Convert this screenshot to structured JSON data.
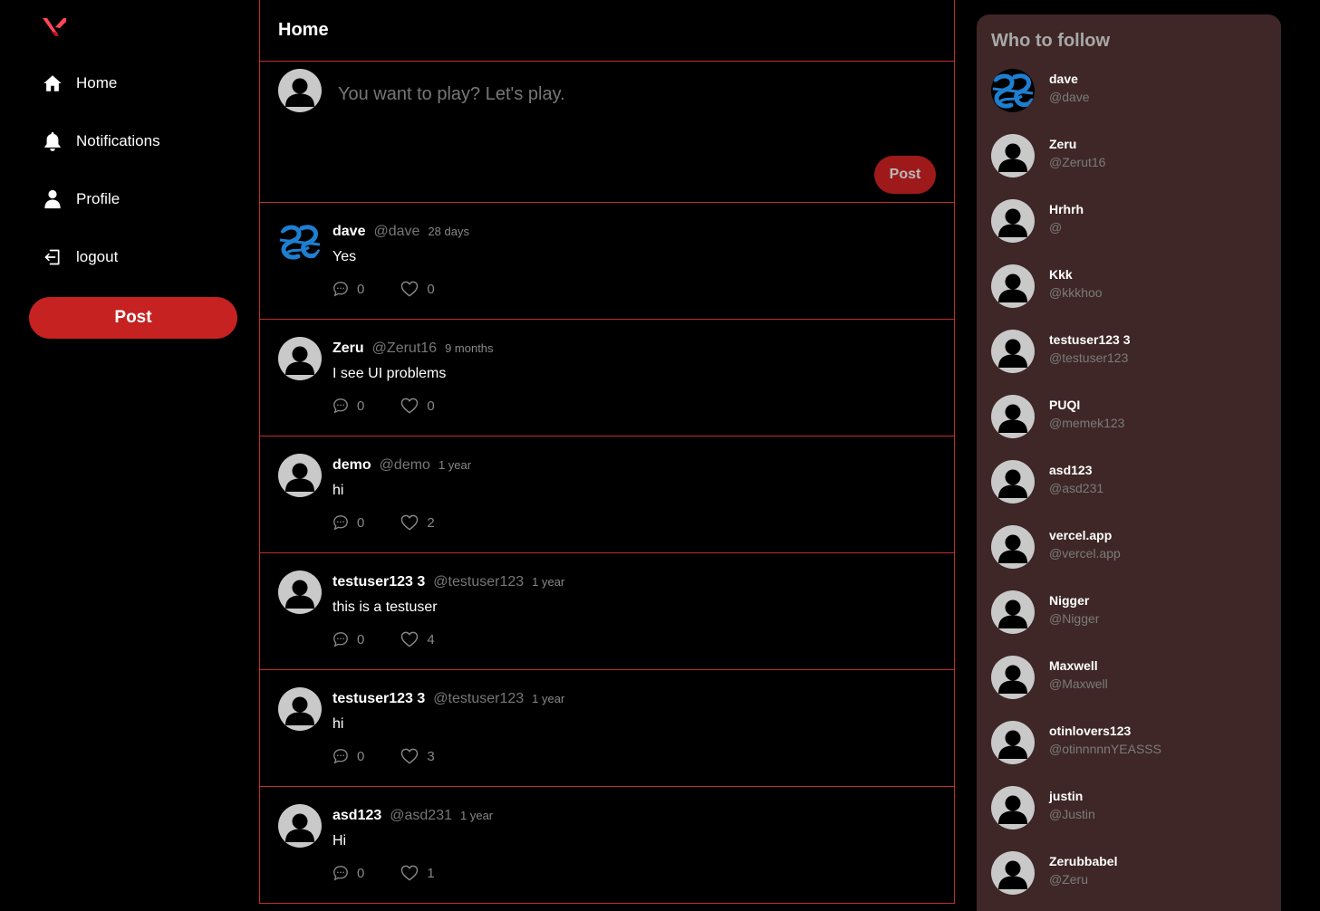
{
  "sidebar": {
    "logo": "v-logo-icon",
    "nav": [
      {
        "label": "Home",
        "icon": "home-icon"
      },
      {
        "label": "Notifications",
        "icon": "bell-icon"
      },
      {
        "label": "Profile",
        "icon": "user-icon"
      },
      {
        "label": "logout",
        "icon": "logout-icon"
      }
    ],
    "post_button": "Post"
  },
  "main": {
    "title": "Home",
    "composer": {
      "placeholder": "You want to play? Let's play.",
      "post_button": "Post"
    },
    "tweets": [
      {
        "name": "dave",
        "handle": "@dave",
        "time": "28 days",
        "text": "Yes",
        "replies": "0",
        "likes": "0",
        "avatar": "brand"
      },
      {
        "name": "Zeru",
        "handle": "@Zerut16",
        "time": "9 months",
        "text": "I see UI problems",
        "replies": "0",
        "likes": "0",
        "avatar": "default"
      },
      {
        "name": "demo",
        "handle": "@demo",
        "time": "1 year",
        "text": "hi",
        "replies": "0",
        "likes": "2",
        "avatar": "default"
      },
      {
        "name": "testuser123 3",
        "handle": "@testuser123",
        "time": "1 year",
        "text": "this is a testuser",
        "replies": "0",
        "likes": "4",
        "avatar": "default"
      },
      {
        "name": "testuser123 3",
        "handle": "@testuser123",
        "time": "1 year",
        "text": "hi",
        "replies": "0",
        "likes": "3",
        "avatar": "default"
      },
      {
        "name": "asd123",
        "handle": "@asd231",
        "time": "1 year",
        "text": "Hi",
        "replies": "0",
        "likes": "1",
        "avatar": "default"
      }
    ]
  },
  "who_to_follow": {
    "title": "Who to follow",
    "users": [
      {
        "name": "dave",
        "handle": "@dave",
        "avatar": "brand"
      },
      {
        "name": "Zeru",
        "handle": "@Zerut16",
        "avatar": "default"
      },
      {
        "name": "Hrhrh",
        "handle": "@",
        "avatar": "default"
      },
      {
        "name": "Kkk",
        "handle": "@kkkhoo",
        "avatar": "default"
      },
      {
        "name": "testuser123 3",
        "handle": "@testuser123",
        "avatar": "default"
      },
      {
        "name": "PUQI",
        "handle": "@memek123",
        "avatar": "default"
      },
      {
        "name": "asd123",
        "handle": "@asd231",
        "avatar": "default"
      },
      {
        "name": "vercel.app",
        "handle": "@vercel.app",
        "avatar": "default"
      },
      {
        "name": "Nigger",
        "handle": "@Nigger",
        "avatar": "default"
      },
      {
        "name": "Maxwell",
        "handle": "@Maxwell",
        "avatar": "default"
      },
      {
        "name": "otinlovers123",
        "handle": "@otinnnnnYEASSS",
        "avatar": "default"
      },
      {
        "name": "justin",
        "handle": "@Justin",
        "avatar": "default"
      },
      {
        "name": "Zerubbabel",
        "handle": "@Zeru",
        "avatar": "default"
      }
    ]
  },
  "colors": {
    "accent": "#c62222",
    "border": "#c0302a",
    "panel_bg": "#3f2727",
    "muted_text": "#777777"
  }
}
